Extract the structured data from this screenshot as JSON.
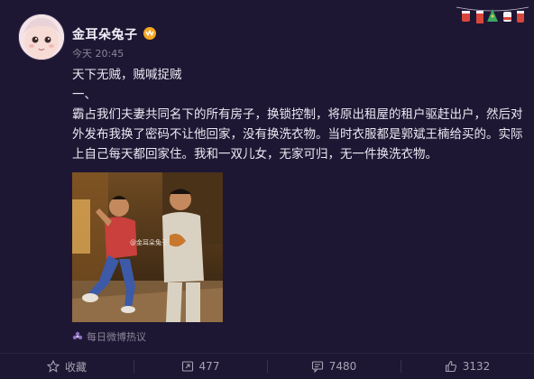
{
  "post": {
    "username": "金耳朵兔子",
    "time": "今天 20:45",
    "paragraphs": [
      "天下无贼，贼喊捉贼",
      "一、",
      "霸占我们夫妻共同名下的所有房子，换锁控制，将原出租屋的租户驱赶出户，然后对外发布我换了密码不让他回家，没有换洗衣物。当时衣服都是郭斌王楠给买的。实际上自己每天都回家住。我和一双儿女，无家可归，无一件换洗衣物。"
    ],
    "photo_watermark": "@金耳朵兔子",
    "source": "每日微博热议"
  },
  "footer": {
    "collect_label": "收藏",
    "repost_count": "477",
    "comment_count": "7480",
    "like_count": "3132"
  },
  "icons": {
    "collect": "star-icon",
    "repost": "repost-icon",
    "comment": "comment-icon",
    "like": "thumbs-up-icon",
    "source": "flower-icon",
    "badge": "vip-badge-icon"
  },
  "colors": {
    "background": "#1e1733",
    "text": "#ece9f3",
    "meta": "#8b8499",
    "badge": "#f5a623"
  }
}
